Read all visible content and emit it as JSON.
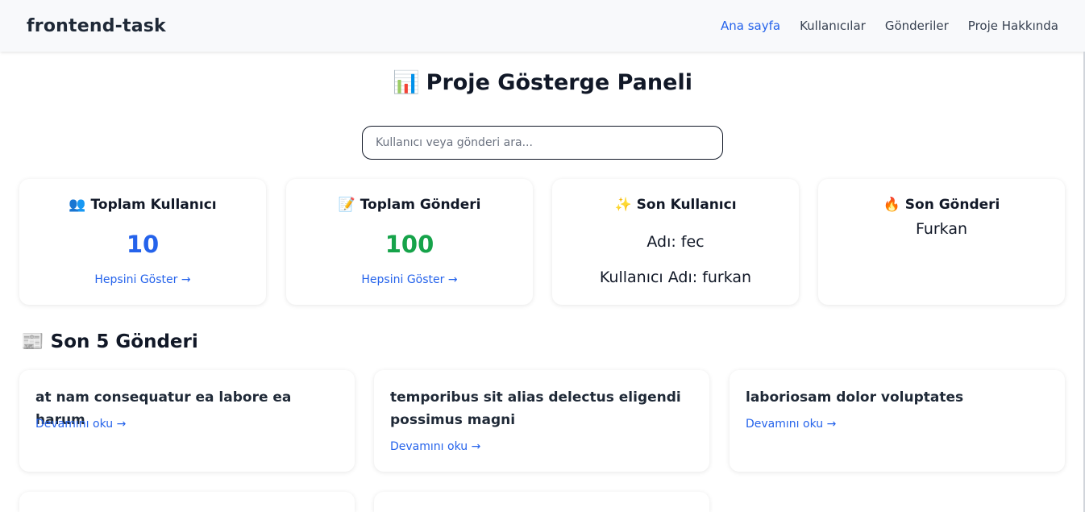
{
  "navbar": {
    "brand": "frontend-task",
    "links": [
      "Ana sayfa",
      "Kullanıcılar",
      "Gönderiler",
      "Proje Hakkında"
    ],
    "active_index": 0
  },
  "page": {
    "title_icon": "📊",
    "title": "Proje Gösterge Paneli"
  },
  "search": {
    "placeholder": "Kullanıcı veya gönderi ara...",
    "value": ""
  },
  "stats": {
    "total_users": {
      "icon": "👥",
      "title": "Toplam Kullanıcı",
      "value": "10",
      "link": "Hepsini Göster →"
    },
    "total_posts": {
      "icon": "📝",
      "title": "Toplam Gönderi",
      "value": "100",
      "link": "Hepsini Göster →"
    },
    "last_user": {
      "icon": "✨",
      "title": "Son Kullanıcı",
      "name_line": "Adı: fec",
      "username_line": "Kullanıcı Adı: furkan"
    },
    "last_post": {
      "icon": "🔥",
      "title": "Son Gönderi",
      "value": "Furkan"
    }
  },
  "recent_posts": {
    "icon": "📰",
    "title": "Son 5 Gönderi",
    "read_more": "Devamını oku →",
    "items": [
      "at nam consequatur ea labore ea harum",
      "temporibus sit alias delectus eligendi possimus magni",
      "laboriosam dolor voluptates"
    ]
  },
  "colors": {
    "accent_blue": "#2563eb",
    "accent_green": "#16a34a",
    "text_dark": "#111827",
    "navbar_bg": "#f8f9fb"
  }
}
